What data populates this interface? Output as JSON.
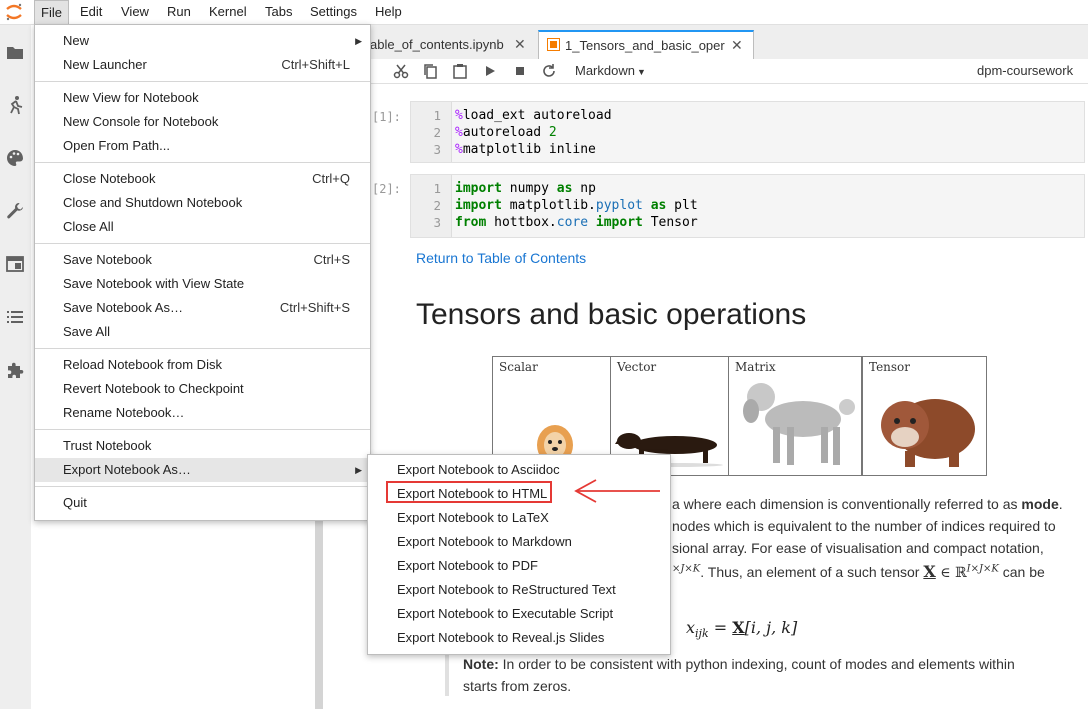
{
  "menubar": {
    "items": [
      "File",
      "Edit",
      "View",
      "Run",
      "Kernel",
      "Tabs",
      "Settings",
      "Help"
    ]
  },
  "tabs": [
    {
      "label": "able_of_contents.ipynb"
    },
    {
      "label": "1_Tensors_and_basic_oper"
    }
  ],
  "toolbar": {
    "cell_type": "Markdown",
    "kernel_name": "dpm-coursework"
  },
  "cells": [
    {
      "prompt": "[1]:",
      "lines": [
        "1",
        "2",
        "3"
      ]
    },
    {
      "prompt": "[2]:",
      "lines": [
        "1",
        "2",
        "3"
      ]
    }
  ],
  "code1": {
    "l1_mg": "%",
    "l1_rest": "load_ext autoreload",
    "l2_mg": "%",
    "l2_rest": "autoreload ",
    "l2_num": "2",
    "l3_mg": "%",
    "l3_rest": "matplotlib inline"
  },
  "code2": {
    "l1_kw": "import",
    "l1_a": " numpy ",
    "l1_kw2": "as",
    "l1_b": " np",
    "l2_kw": "import",
    "l2_a": " matplotlib.",
    "l2_mod": "pyplot",
    "l2_sp": " ",
    "l2_kw2": "as",
    "l2_b": " plt",
    "l3_kw": "from",
    "l3_a": " hottbox.",
    "l3_mod": "core",
    "l3_sp": " ",
    "l3_kw2": "import",
    "l3_b": " Tensor"
  },
  "markdown": {
    "link": "Return to Table of Contents",
    "heading": "Tensors and basic operations",
    "img_captions": [
      "Scalar",
      "Vector",
      "Matrix",
      "Tensor"
    ],
    "p1_a": "a where each dimension is conventionally referred to as ",
    "p1_b": "mode",
    "p1_c": ".",
    "p2": "nodes which is equivalent to the number of indices required to",
    "p3": "sional array. For ease of visualisation and compact notation,",
    "p4_a": "×J×K",
    "p4_b": ". Thus, an element of a such tensor ",
    "p4_c": "X",
    "p4_d": " ∈ ℝ",
    "p4_e": "I×J×K",
    "p4_f": " can be",
    "formula_lhs": "x",
    "formula_sub": "ijk",
    "formula_eq": " = ",
    "formula_X": "X",
    "formula_rhs": "[i, j, k]",
    "note_bold": "Note:",
    "note_text": " In order to be consistent with python indexing, count of modes and elements within",
    "note_text2": "starts from zeros."
  },
  "file_menu": {
    "items": [
      {
        "label": "New",
        "shortcut": "",
        "submenu": true
      },
      {
        "label": "New Launcher",
        "shortcut": "Ctrl+Shift+L"
      },
      {
        "label": "New View for Notebook",
        "shortcut": ""
      },
      {
        "label": "New Console for Notebook",
        "shortcut": ""
      },
      {
        "label": "Open From Path...",
        "shortcut": ""
      },
      {
        "label": "Close Notebook",
        "shortcut": "Ctrl+Q"
      },
      {
        "label": "Close and Shutdown Notebook",
        "shortcut": ""
      },
      {
        "label": "Close All",
        "shortcut": ""
      },
      {
        "label": "Save Notebook",
        "shortcut": "Ctrl+S"
      },
      {
        "label": "Save Notebook with View State",
        "shortcut": ""
      },
      {
        "label": "Save Notebook As…",
        "shortcut": "Ctrl+Shift+S"
      },
      {
        "label": "Save All",
        "shortcut": ""
      },
      {
        "label": "Reload Notebook from Disk",
        "shortcut": ""
      },
      {
        "label": "Revert Notebook to Checkpoint",
        "shortcut": ""
      },
      {
        "label": "Rename Notebook…",
        "shortcut": ""
      },
      {
        "label": "Trust Notebook",
        "shortcut": ""
      },
      {
        "label": "Export Notebook As…",
        "shortcut": "",
        "submenu": true
      },
      {
        "label": "Quit",
        "shortcut": ""
      }
    ]
  },
  "export_menu": {
    "items": [
      "Export Notebook to Asciidoc",
      "Export Notebook to HTML",
      "Export Notebook to LaTeX",
      "Export Notebook to Markdown",
      "Export Notebook to PDF",
      "Export Notebook to ReStructured Text",
      "Export Notebook to Executable Script",
      "Export Notebook to Reveal.js Slides"
    ],
    "highlighted_index": 1
  },
  "colors": {
    "accent": "#2196f3",
    "annotation": "#e53935",
    "menu_highlight": "#e6e6e6"
  }
}
